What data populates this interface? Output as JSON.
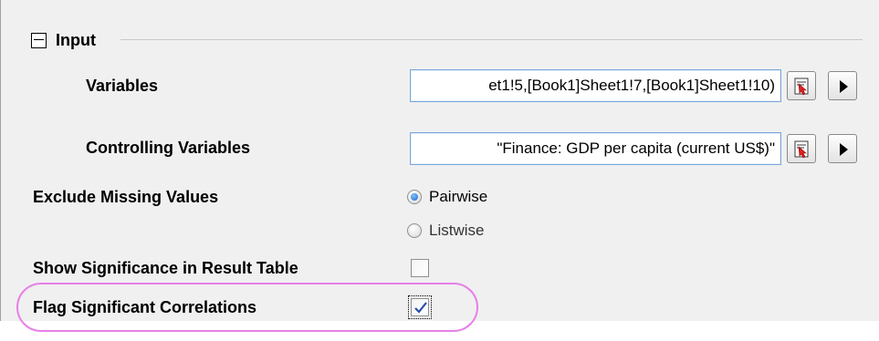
{
  "group": {
    "title": "Input",
    "icon": "collapse-minus-icon"
  },
  "variables": {
    "label": "Variables",
    "value": "et1!5,[Book1]Sheet1!7,[Book1]Sheet1!10)"
  },
  "controlling_variables": {
    "label": "Controlling Variables",
    "value": "\"Finance: GDP per capita (current US$)\""
  },
  "exclude_missing": {
    "label": "Exclude Missing Values",
    "options": [
      {
        "label": "Pairwise",
        "selected": true
      },
      {
        "label": "Listwise",
        "selected": false
      }
    ]
  },
  "show_significance": {
    "label": "Show Significance in Result Table",
    "checked": false
  },
  "flag_significant": {
    "label": "Flag Significant Correlations",
    "checked": true
  },
  "icons": {
    "select": "select-columns-icon",
    "arrow": "arrow-right-icon"
  },
  "colors": {
    "highlight": "#e77fe7",
    "field_border": "#7aa7d9",
    "radio_selected": "#1a65c1"
  }
}
